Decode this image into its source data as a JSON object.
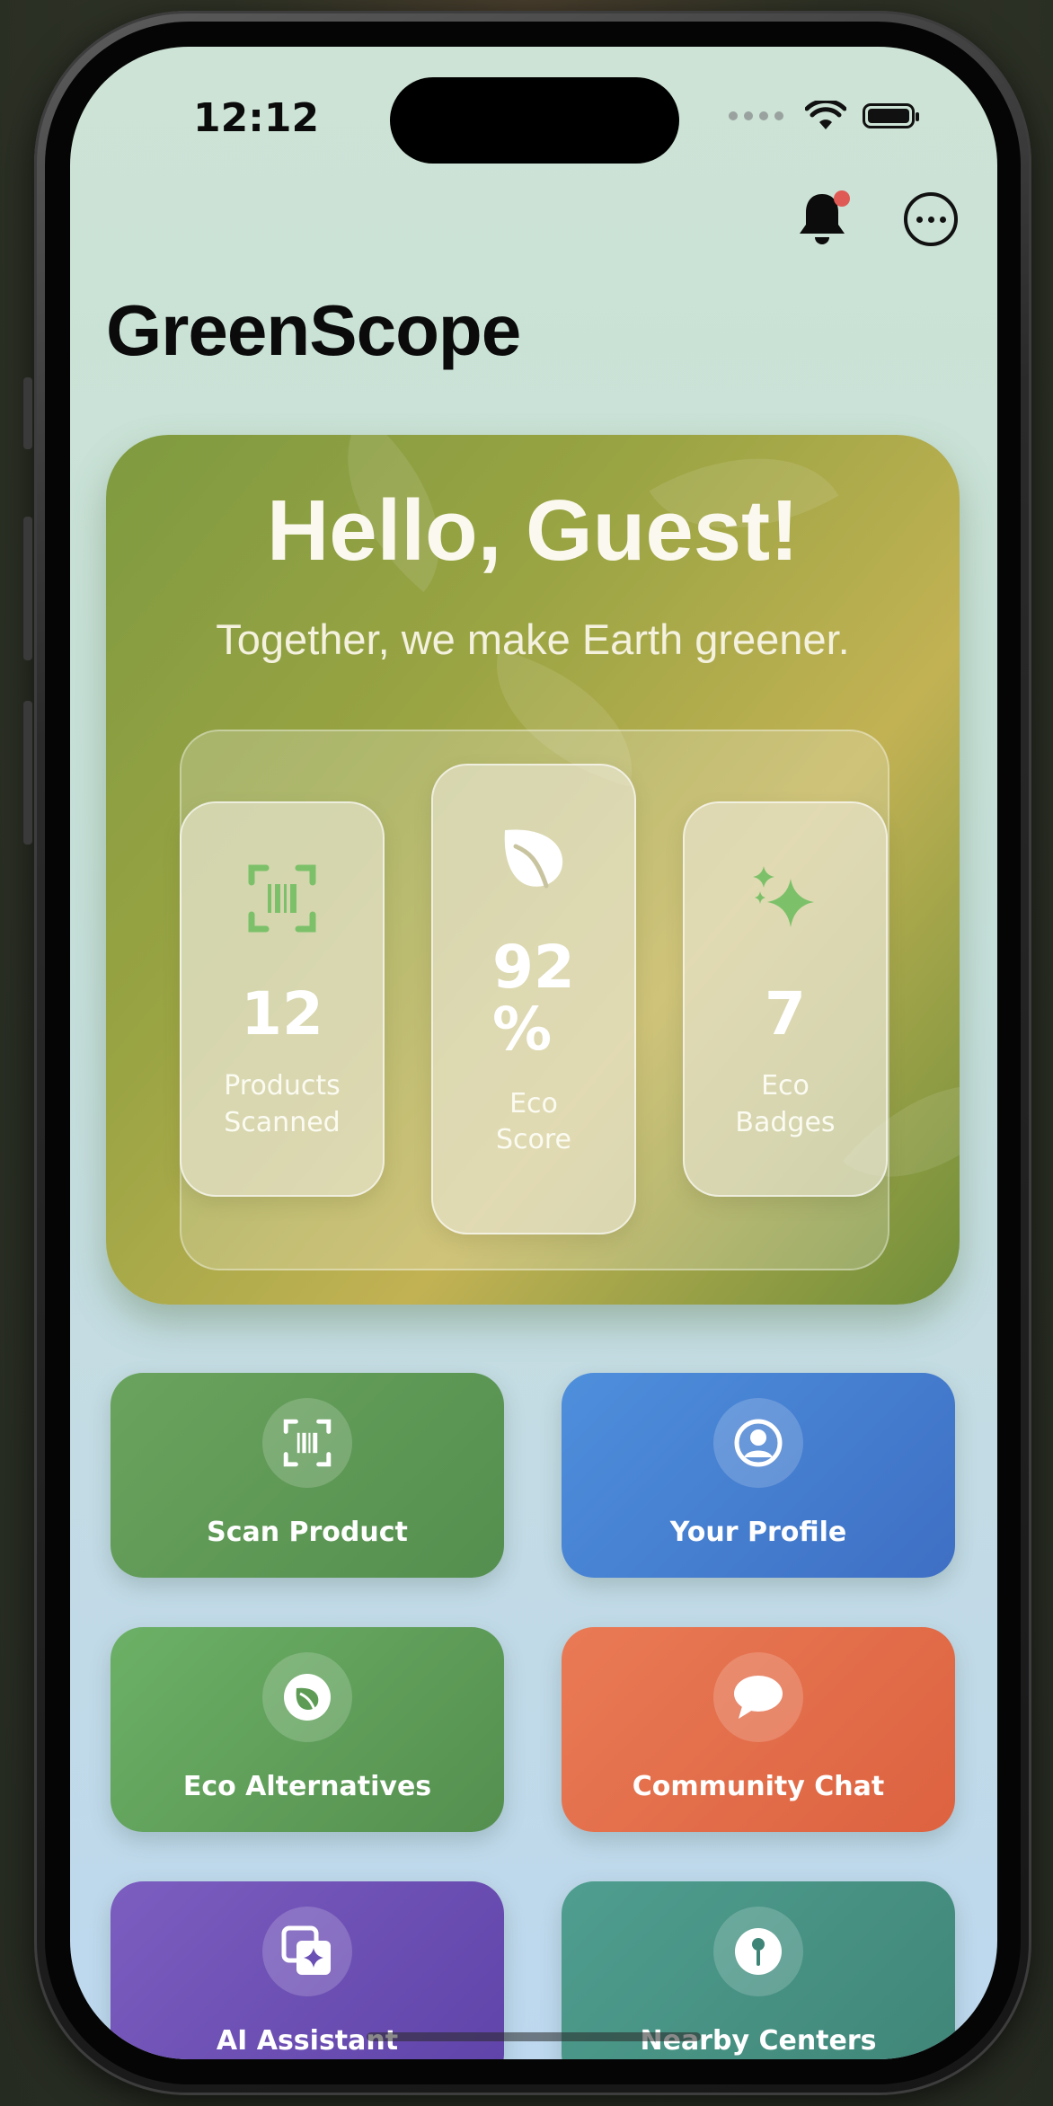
{
  "status_bar": {
    "time": "12:12"
  },
  "app": {
    "title": "GreenScope"
  },
  "hero": {
    "greeting": "Hello, Guest!",
    "subtitle": "Together, we make Earth greener."
  },
  "stats": [
    {
      "value": "12",
      "label_line1": "Products",
      "label_line2": "Scanned",
      "icon": "barcode-scan-icon"
    },
    {
      "value_line1": "92",
      "value_line2": "%",
      "label_line1": "Eco",
      "label_line2": "Score",
      "icon": "leaf-icon"
    },
    {
      "value": "7",
      "label_line1": "Eco",
      "label_line2": "Badges",
      "icon": "sparkles-icon"
    }
  ],
  "tiles": [
    {
      "label": "Scan Product",
      "icon": "barcode-scan-icon",
      "color_from": "#6aa35d",
      "color_to": "#548f4f"
    },
    {
      "label": "Your Profile",
      "icon": "person-circle-icon",
      "color_from": "#4e8fdc",
      "color_to": "#3e6fc4"
    },
    {
      "label": "Eco Alternatives",
      "icon": "leaf-circle-icon",
      "color_from": "#6cb066",
      "color_to": "#548f4f"
    },
    {
      "label": "Community Chat",
      "icon": "chat-bubble-icon",
      "color_from": "#e97a55",
      "color_to": "#dd6240"
    },
    {
      "label": "AI Assistant",
      "icon": "ai-sparkle-icon",
      "color_from": "#7c5dc0",
      "color_to": "#5f43a8"
    },
    {
      "label": "Nearby Centers",
      "icon": "map-pin-icon",
      "color_from": "#4f9e8f",
      "color_to": "#3f8577"
    }
  ],
  "colors": {
    "notification_badge": "#e05a55",
    "stat_icon_green": "#7cc16a"
  }
}
